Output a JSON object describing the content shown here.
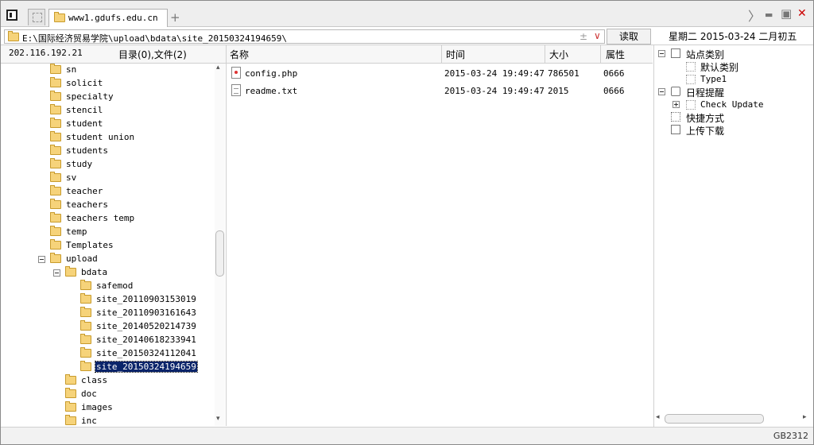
{
  "titlebar": {
    "tab_title": "www1.gdufs.edu.cn",
    "tab_close_glyph": "×",
    "add_tab_glyph": "+",
    "nav_forward_glyph": "〉",
    "minimize_glyph": "▬",
    "maximize_glyph": "▣",
    "close_glyph": "✕",
    "close_color": "#cc0000"
  },
  "address": {
    "path": "E:\\国际经济贸易学院\\upload\\bdata\\site_20150324194659\\",
    "plus_minus_glyph": "±",
    "dropdown_glyph": "∨",
    "read_button": "读取"
  },
  "date": {
    "text": "星期二 2015-03-24 二月初五"
  },
  "server": {
    "ip": "202.116.192.21",
    "summary": "目录(0),文件(2)"
  },
  "columns": {
    "name": "名称",
    "time": "时间",
    "size": "大小",
    "attr": "属性"
  },
  "tree": {
    "items": [
      {
        "label": "sn"
      },
      {
        "label": "solicit"
      },
      {
        "label": "specialty"
      },
      {
        "label": "stencil"
      },
      {
        "label": "student"
      },
      {
        "label": "student union"
      },
      {
        "label": "students"
      },
      {
        "label": "study"
      },
      {
        "label": "sv"
      },
      {
        "label": "teacher"
      },
      {
        "label": "teachers"
      },
      {
        "label": "teachers temp"
      },
      {
        "label": "temp"
      },
      {
        "label": "Templates"
      },
      {
        "label": "upload"
      },
      {
        "label": "bdata"
      },
      {
        "label": "safemod"
      },
      {
        "label": "site_20110903153019"
      },
      {
        "label": "site_20110903161643"
      },
      {
        "label": "site_20140520214739"
      },
      {
        "label": "site_20140618233941"
      },
      {
        "label": "site_20150324112041"
      },
      {
        "label": "site_20150324194659"
      },
      {
        "label": "class"
      },
      {
        "label": "doc"
      },
      {
        "label": "images"
      },
      {
        "label": "inc"
      }
    ],
    "scroll_up_glyph": "▴",
    "scroll_down_glyph": "▾"
  },
  "files": [
    {
      "name": "config.php",
      "time": "2015-03-24 19:49:47",
      "size": "786501",
      "attr": "0666",
      "icon": "php-file-icon"
    },
    {
      "name": "readme.txt",
      "time": "2015-03-24 19:49:47",
      "size": "2015",
      "attr": "0666",
      "icon": "text-file-icon"
    }
  ],
  "right_panel": {
    "site_category": "站点类别",
    "default_category": "默认类别",
    "type1": "Type1",
    "schedule": "日程提醒",
    "check_update": "Check Update",
    "shortcuts": "快捷方式",
    "transfer": "上传下载",
    "scroll_left_glyph": "◂",
    "scroll_right_glyph": "▸"
  },
  "status": {
    "encoding": "GB2312"
  }
}
